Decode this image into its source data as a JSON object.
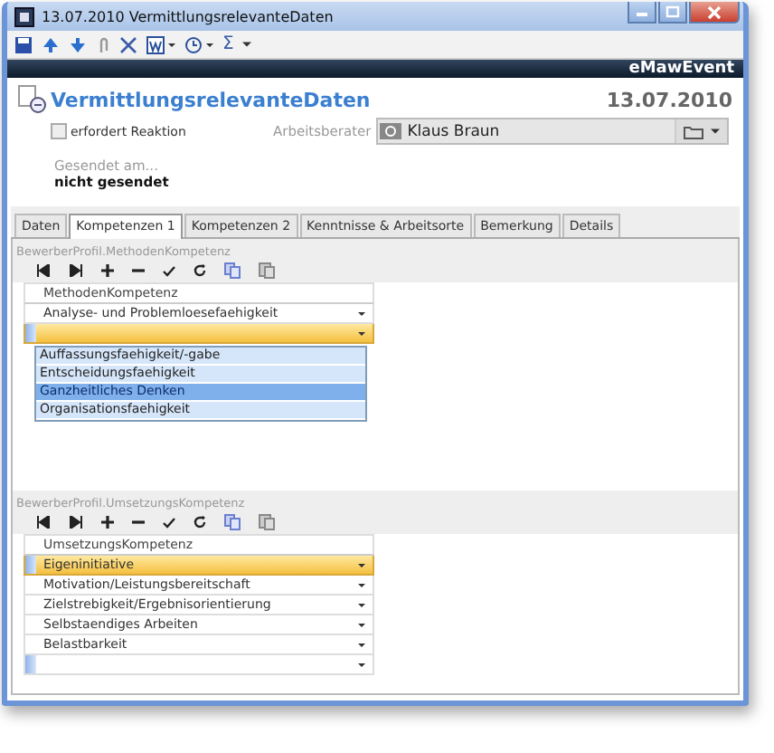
{
  "window": {
    "title": "13.07.2010 VermittlungsrelevanteDaten"
  },
  "toolbar": {
    "sum_symbol": "Σ"
  },
  "brand": "eMawEvent",
  "header": {
    "title": "VermittlungsrelevanteDaten",
    "date": "13.07.2010"
  },
  "reaction": {
    "label": "erfordert Reaktion",
    "checked": false
  },
  "advisor": {
    "label": "Arbeitsberater",
    "value": "Klaus Braun"
  },
  "sent": {
    "label": "Gesendet am...",
    "value": "nicht gesendet"
  },
  "tabs": [
    {
      "label": "Daten",
      "selected": false
    },
    {
      "label": "Kompetenzen 1",
      "selected": true
    },
    {
      "label": "Kompetenzen 2",
      "selected": false
    },
    {
      "label": "Kenntnisse & Arbeitsorte",
      "selected": false
    },
    {
      "label": "Bemerkung",
      "selected": false
    },
    {
      "label": "Details",
      "selected": false
    }
  ],
  "grids": [
    {
      "caption": "BewerberProfil.MethodenKompetenz",
      "column": "MethodenKompetenz",
      "rows": [
        {
          "kind": "item",
          "value": "Analyse- und Problemloesefaehigkeit",
          "selected": false
        },
        {
          "kind": "new",
          "selected": true
        }
      ],
      "dropdown": [
        {
          "label": "Auffassungsfaehigkeit/-gabe",
          "selected": false
        },
        {
          "label": "Entscheidungsfaehigkeit",
          "selected": false
        },
        {
          "label": "Ganzheitliches Denken",
          "selected": true
        },
        {
          "label": "Organisationsfaehigkeit",
          "selected": false
        }
      ]
    },
    {
      "caption": "BewerberProfil.UmsetzungsKompetenz",
      "column": "UmsetzungsKompetenz",
      "rows": [
        {
          "kind": "item",
          "value": "Eigeninitiative",
          "selected": true
        },
        {
          "kind": "item",
          "value": "Motivation/Leistungsbereitschaft",
          "selected": false
        },
        {
          "kind": "item",
          "value": "Zielstrebigkeit/Ergebnisorientierung",
          "selected": false
        },
        {
          "kind": "item",
          "value": "Selbstaendiges Arbeiten",
          "selected": false
        },
        {
          "kind": "item",
          "value": "Belastbarkeit",
          "selected": false
        },
        {
          "kind": "new",
          "selected": false
        }
      ]
    }
  ]
}
